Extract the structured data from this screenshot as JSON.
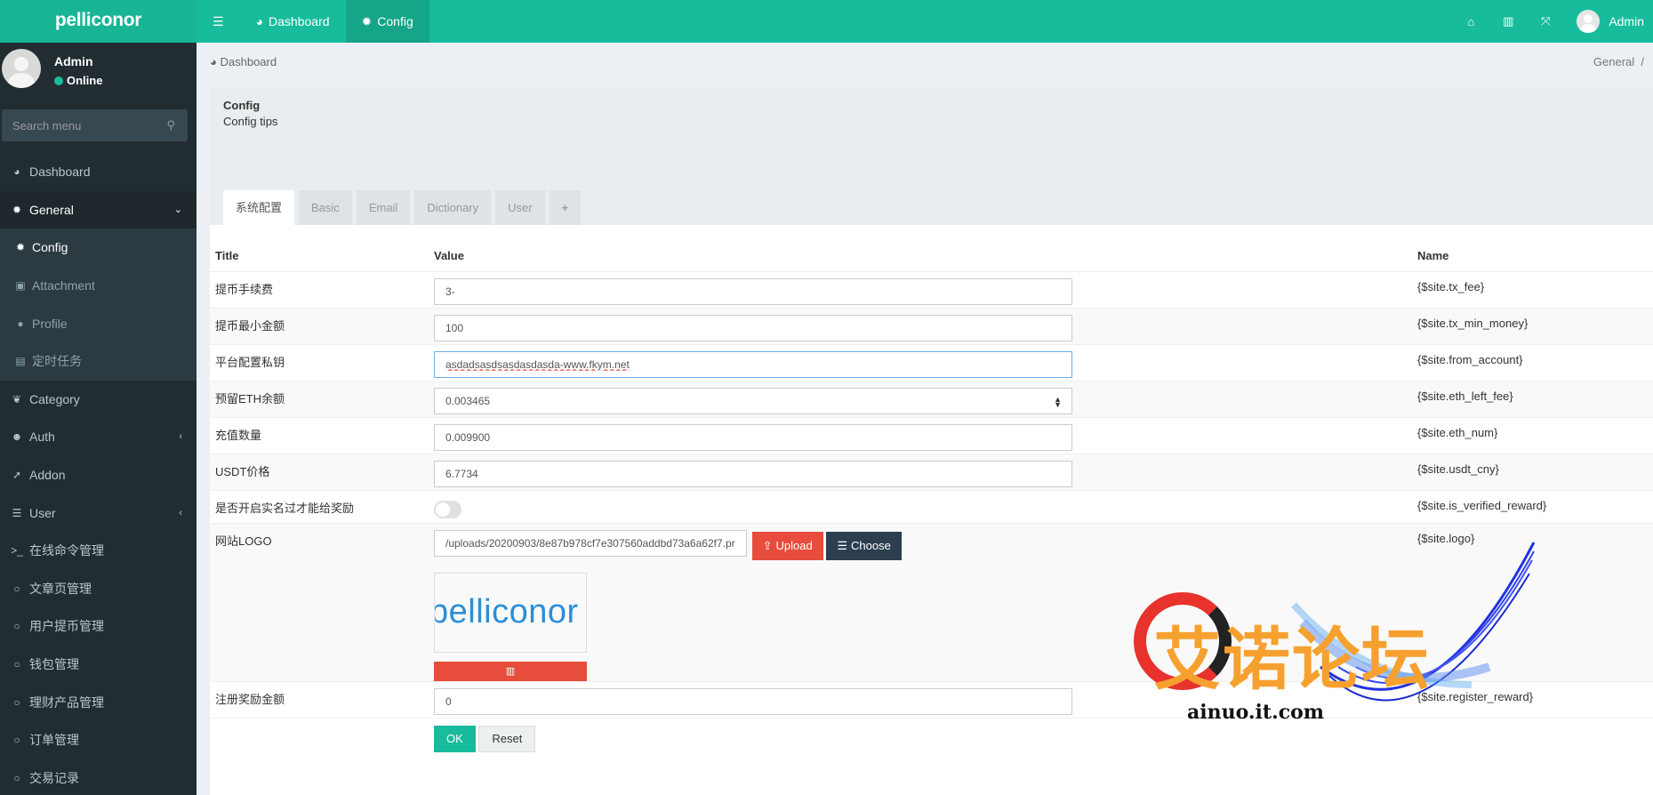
{
  "app": {
    "logo": "pelliconor"
  },
  "topnav": [
    {
      "label": "Dashboard",
      "icon": "dashboard-icon"
    },
    {
      "label": "Config",
      "icon": "gear-icon",
      "active": true
    }
  ],
  "topright": {
    "user": "Admin"
  },
  "sidebar": {
    "user_name": "Admin",
    "status": "Online",
    "search_placeholder": "Search menu",
    "items": [
      {
        "label": "Dashboard",
        "icon": "dashboard-icon"
      },
      {
        "label": "General",
        "icon": "cogs-icon",
        "expanded": true
      },
      {
        "label": "Config",
        "icon": "gear-icon"
      },
      {
        "label": "Attachment",
        "icon": "image-icon"
      },
      {
        "label": "Profile",
        "icon": "user-icon"
      },
      {
        "label": "定时任务",
        "icon": "tasks-icon"
      },
      {
        "label": "Category",
        "icon": "leaf-icon"
      },
      {
        "label": "Auth",
        "icon": "users-icon"
      },
      {
        "label": "Addon",
        "icon": "rocket-icon"
      },
      {
        "label": "User",
        "icon": "list-icon"
      },
      {
        "label": "在线命令管理",
        "icon": "terminal-icon"
      },
      {
        "label": "文章页管理",
        "icon": "circle-icon"
      },
      {
        "label": "用户提币管理",
        "icon": "circle-icon"
      },
      {
        "label": "钱包管理",
        "icon": "circle-icon"
      },
      {
        "label": "理财产品管理",
        "icon": "circle-icon"
      },
      {
        "label": "订单管理",
        "icon": "circle-icon"
      },
      {
        "label": "交易记录",
        "icon": "circle-icon"
      }
    ]
  },
  "breadcrumb": {
    "left": "Dashboard",
    "right": "General",
    "sep": "/"
  },
  "panel": {
    "title": "Config",
    "tips": "Config tips",
    "tabs": [
      "系统配置",
      "Basic",
      "Email",
      "Dictionary",
      "User",
      "+"
    ]
  },
  "table": {
    "headers": {
      "title": "Title",
      "value": "Value",
      "name": "Name"
    },
    "rows": [
      {
        "title": "提币手续费",
        "value": "3-",
        "name": "{$site.tx_fee}"
      },
      {
        "title": "提币最小金额",
        "value": "100",
        "name": "{$site.tx_min_money}"
      },
      {
        "title": "平台配置私钥",
        "value": "asdadsasdsasdasdasda-www.fkym.net",
        "name": "{$site.from_account}"
      },
      {
        "title": "预留ETH余额",
        "value": "0.003465",
        "name": "{$site.eth_left_fee}"
      },
      {
        "title": "充值数量",
        "value": "0.009900",
        "name": "{$site.eth_num}"
      },
      {
        "title": "USDT价格",
        "value": "6.7734",
        "name": "{$site.usdt_cny}"
      },
      {
        "title": "是否开启实名过才能给奖励",
        "value": false,
        "name": "{$site.is_verified_reward}"
      },
      {
        "title": "网站LOGO",
        "value": "/uploads/20200903/8e87b978cf7e307560addbd73a6a62f7.pr",
        "name": "{$site.logo}",
        "logo_preview": "pelliconor"
      },
      {
        "title": "注册奖励金额",
        "value": "0",
        "name": "{$site.register_reward}"
      }
    ]
  },
  "buttons": {
    "upload": "Upload",
    "choose": "Choose",
    "ok": "OK",
    "reset": "Reset"
  },
  "watermark": {
    "text": "艾诺论坛",
    "url": "ainuo.it.com"
  },
  "colors": {
    "primary": "#18bc9c",
    "sidebar": "#222d32",
    "danger": "#e74c3c",
    "dark": "#2c3e50"
  }
}
